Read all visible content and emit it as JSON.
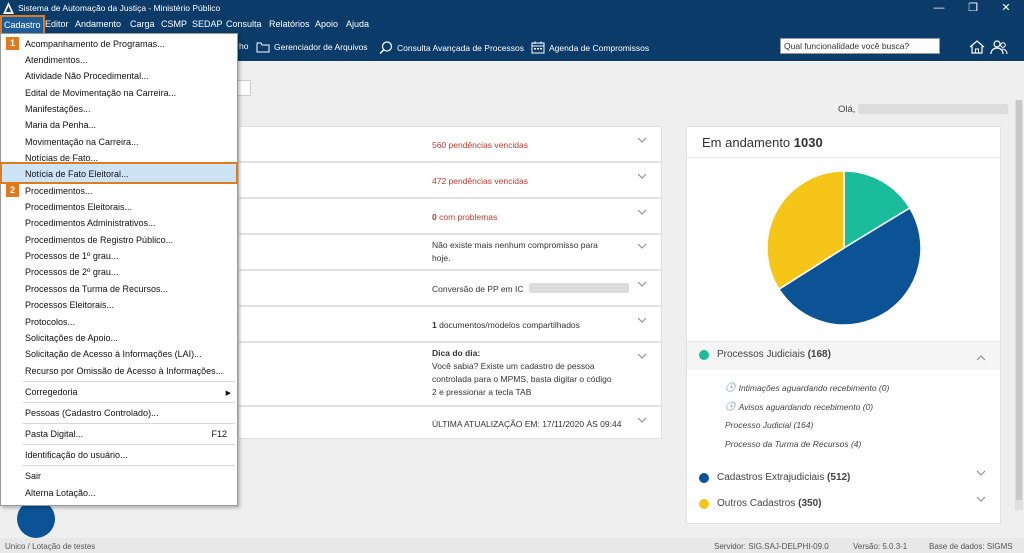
{
  "window": {
    "title": "Sistema de Automação da Justiça - Ministério Público",
    "minimize": "—",
    "maximize": "❐",
    "close": "✕"
  },
  "menubar": [
    "Cadastro",
    "Editor",
    "Andamento",
    "Carga",
    "CSMP",
    "SEDAP",
    "Consulta",
    "Relatórios",
    "Apoio",
    "Ajuda"
  ],
  "toolbar": {
    "item_partial": "ho",
    "file_manager": "Gerenciador de Arquivos",
    "advanced_search": "Consulta Avançada de Processos",
    "agenda": "Agenda de Compromissos",
    "search_placeholder": "Qual funcionalidade você busca?"
  },
  "greeting": "Olá,",
  "cards": [
    {
      "text": "560 pendências vencidas",
      "number": "560",
      "rest": " pendências vencidas",
      "color": "red"
    },
    {
      "text": "472 pendências vencidas",
      "number": "472",
      "rest": " pendências vencidas",
      "color": "red"
    },
    {
      "text": "0 com problemas",
      "number": "0",
      "rest": " com problemas",
      "color": "red"
    },
    {
      "text": "Não existe mais nenhum compromisso para hoje.",
      "line1": "Não existe mais nenhum compromisso para",
      "line2": "hoje."
    },
    {
      "text": "Conversão de PP em IC"
    },
    {
      "number": "1",
      "rest": " documentos/modelos compartilhados"
    },
    {
      "title": "Dica do dia:",
      "line1": "Você sabia? Existe um cadastro de pessoa",
      "line2": "controlada para o MPMS, basta digitar o código",
      "line3": "2 e pressionar a tecla TAB"
    },
    {
      "text": "ÚLTIMA ATUALIZAÇÃO EM: 17/11/2020 ÀS 09:44"
    }
  ],
  "panel": {
    "title_prefix": "Em andamento ",
    "title_count": "1030",
    "legend": [
      {
        "label": "Processos Judiciais",
        "count": "(168)",
        "color": "#1abc9c"
      },
      {
        "label": "Cadastros Extrajudiciais",
        "count": "(512)",
        "color": "#0b5394"
      },
      {
        "label": "Outros Cadastros",
        "count": "(350)",
        "color": "#f5c518"
      }
    ],
    "subitems": [
      "Intimações aguardando recebimento (0)",
      "Avisos aguardando recebimento (0)",
      "Processo Judicial (164)",
      "Processo da Turma de Recursos (4)"
    ]
  },
  "chart_data": {
    "type": "pie",
    "categories": [
      "Processos Judiciais",
      "Cadastros Extrajudiciais",
      "Outros Cadastros"
    ],
    "values": [
      168,
      512,
      350
    ],
    "colors": [
      "#1abc9c",
      "#0b5394",
      "#f5c518"
    ]
  },
  "dropdown": {
    "badge1": "1",
    "badge2": "2",
    "items": [
      "Acompanhamento de Programas...",
      "Atendimentos...",
      "Atividade Não Procedimental...",
      "Edital de Movimentação na Carreira...",
      "Manifestações...",
      "Maria da Penha...",
      "Movimentação na Carreira...",
      "Notícias de Fato...",
      "Notícia de Fato Eleitoral...",
      "Procedimentos...",
      "Procedimentos Eleitorais...",
      "Procedimentos Administrativos...",
      "Procedimentos de Registro Público...",
      "Processos de 1º grau...",
      "Processos de 2º grau...",
      "Processos da Turma de Recursos...",
      "Processos Eleitorais...",
      "Protocolos...",
      "Solicitações de Apoio...",
      "Solicitação de Acesso à Informações (LAI)...",
      "Recurso por Omissão de Acesso à Informações...",
      "Corregedoria",
      "Pessoas (Cadastro Controlado)...",
      "Pasta Digital...",
      "Identificação do usuário...",
      "Sair",
      "Alterna Lotação..."
    ],
    "shortcut_pasta": "F12",
    "submenu_arrow": "▶"
  },
  "statusbar": {
    "left": "Unico / Lotação de testes",
    "server": "Servidor: SIG.SAJ-DELPHI-09.0",
    "version": "Versão: 5.0.3-1",
    "database": "Base de dados: SIGMS"
  }
}
